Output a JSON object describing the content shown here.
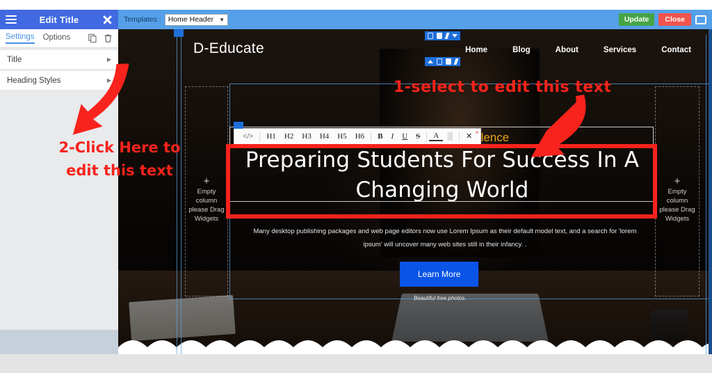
{
  "panel": {
    "title": "Edit Title",
    "menu_icon": "hamburger-icon",
    "close_icon": "close-icon",
    "tabs": [
      {
        "label": "Settings",
        "active": true
      },
      {
        "label": "Options",
        "active": false
      }
    ],
    "tab_icons": [
      "copy-icon",
      "trash-icon"
    ],
    "rows": [
      {
        "label": "Title",
        "chevron": "▶"
      },
      {
        "label": "Heading Styles",
        "chevron": "▶"
      }
    ]
  },
  "topbar": {
    "templates_label": "Templates :",
    "template_selected": "Home Header",
    "template_caret": "▼",
    "update_label": "Update",
    "close_label": "Close",
    "monitor_icon": "monitor-icon"
  },
  "site": {
    "logo": "D-Educate",
    "nav": [
      "Home",
      "Blog",
      "About",
      "Services",
      "Contact"
    ]
  },
  "hero": {
    "eyebrow": "Excellence",
    "headline": "Preparing Students For Success In A Changing World",
    "subcopy": "Many desktop publishing packages and web page editors now use Lorem Ipsum as their default model text, and a search for 'lorem ipsum' will uncover many web sites still in their infancy. .",
    "cta_label": "Learn More",
    "photo_credit": "Beautiful free photos."
  },
  "empty_columns": {
    "plus": "+",
    "text": "Empty column please Drag Widgets"
  },
  "editor_toolbar": {
    "code_icon": "</>",
    "headings": [
      "H1",
      "H2",
      "H3",
      "H4",
      "H5",
      "H6"
    ],
    "bold": "B",
    "italic": "I",
    "underline": "U",
    "strike": "S",
    "text_color": "A",
    "highlight": "░",
    "clear_format": "✕",
    "close_icon": "×"
  },
  "widget_bars": {
    "icons_top": [
      "copy-icon",
      "trash-icon",
      "pencil-icon",
      "caret-down-icon"
    ],
    "icons_bottom": [
      "caret-up-icon",
      "copy-icon",
      "trash-icon",
      "pencil-icon"
    ]
  },
  "annotations": {
    "one": "1-select to edit this text",
    "two_line1": "2-Click Here to",
    "two_line2": "edit this text"
  },
  "colors": {
    "panel_header": "#4169e1",
    "topbar": "#55a0e8",
    "update": "#45a545",
    "close": "#f0544d",
    "annotation_red": "#f8231c",
    "cta_blue": "#0a55e8",
    "eyebrow_gold": "#e8a317"
  }
}
